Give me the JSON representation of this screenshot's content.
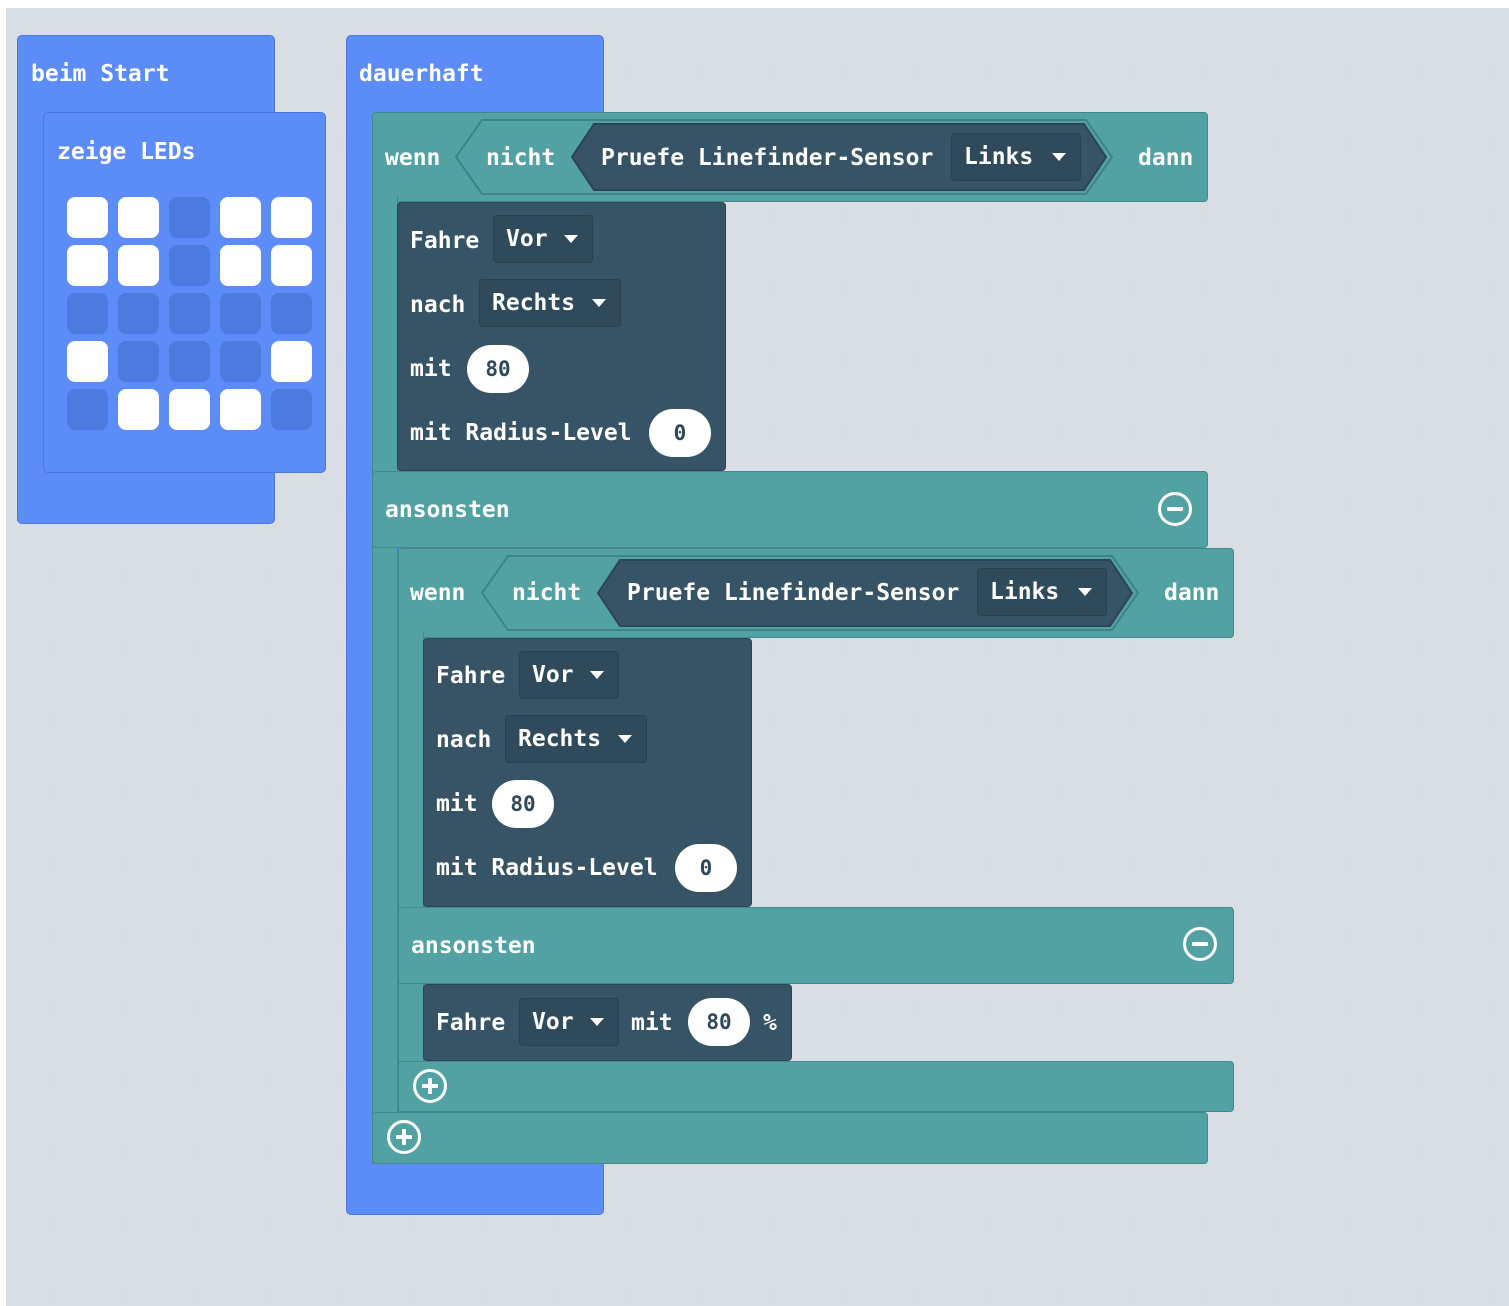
{
  "colors": {
    "canvas": "#e9edf0",
    "basic_blue": "#5b8cf8",
    "logic_teal": "#52a2a3",
    "sensor_dark": "#375466",
    "dropdown_dark": "#2f4a5a",
    "led_on": "#ffffff",
    "led_off": "#4c7ade"
  },
  "on_start": {
    "label": "beim Start",
    "show_leds": {
      "label": "zeige LEDs",
      "grid": [
        [
          1,
          1,
          0,
          1,
          1
        ],
        [
          1,
          1,
          0,
          1,
          1
        ],
        [
          0,
          0,
          0,
          0,
          0
        ],
        [
          1,
          0,
          0,
          0,
          1
        ],
        [
          0,
          1,
          1,
          1,
          0
        ]
      ]
    }
  },
  "forever": {
    "label": "dauerhaft",
    "if_block": {
      "if_label": "wenn",
      "not_label": "nicht",
      "sensor_label": "Pruefe Linefinder-Sensor",
      "sensor_side": "Links",
      "then_label": "dann",
      "drive": {
        "drive_label": "Fahre",
        "direction": "Vor",
        "toward_label": "nach",
        "turn": "Rechts",
        "with_label": "mit",
        "speed": "80",
        "radius_label": "mit Radius-Level",
        "radius": "0"
      },
      "else_label": "ansonsten",
      "else_if": {
        "if_label": "wenn",
        "not_label": "nicht",
        "sensor_label": "Pruefe Linefinder-Sensor",
        "sensor_side": "Links",
        "then_label": "dann",
        "drive": {
          "drive_label": "Fahre",
          "direction": "Vor",
          "toward_label": "nach",
          "turn": "Rechts",
          "with_label": "mit",
          "speed": "80",
          "radius_label": "mit Radius-Level",
          "radius": "0"
        },
        "else_label": "ansonsten",
        "else_drive": {
          "drive_label": "Fahre",
          "direction": "Vor",
          "with_label": "mit",
          "speed": "80",
          "unit": "%"
        }
      }
    }
  }
}
